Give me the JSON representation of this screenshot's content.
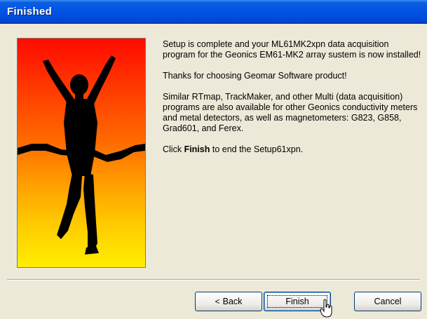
{
  "window": {
    "title": "Finished"
  },
  "message": {
    "para1": "Setup is complete and your ML61MK2xpn data acquisition program for the Geonics EM61-MK2 array sustem is now installed!",
    "para2": "Thanks for choosing Geomar Software product!",
    "para3": "Similar RTmap, TrackMaker, and other Multi (data acquisition) programs are also available for other Geonics conductivity meters and metal detectors, as well as magnetometers: G823, G858, Grad601, and Ferex.",
    "para4_prefix": "Click ",
    "para4_bold": "Finish",
    "para4_suffix": " to end the Setup61xpn."
  },
  "buttons": {
    "back_arrow": "<",
    "back_label": "Back",
    "finish_label": "Finish",
    "cancel_label": "Cancel"
  },
  "image": {
    "icon": "finish-line-runner-silhouette",
    "gradient_top": "#ff0a00",
    "gradient_bottom": "#ffee00"
  },
  "colors": {
    "titlebar": "#0254e3",
    "dialog_bg": "#ece9d8",
    "button_border": "#003c74"
  }
}
